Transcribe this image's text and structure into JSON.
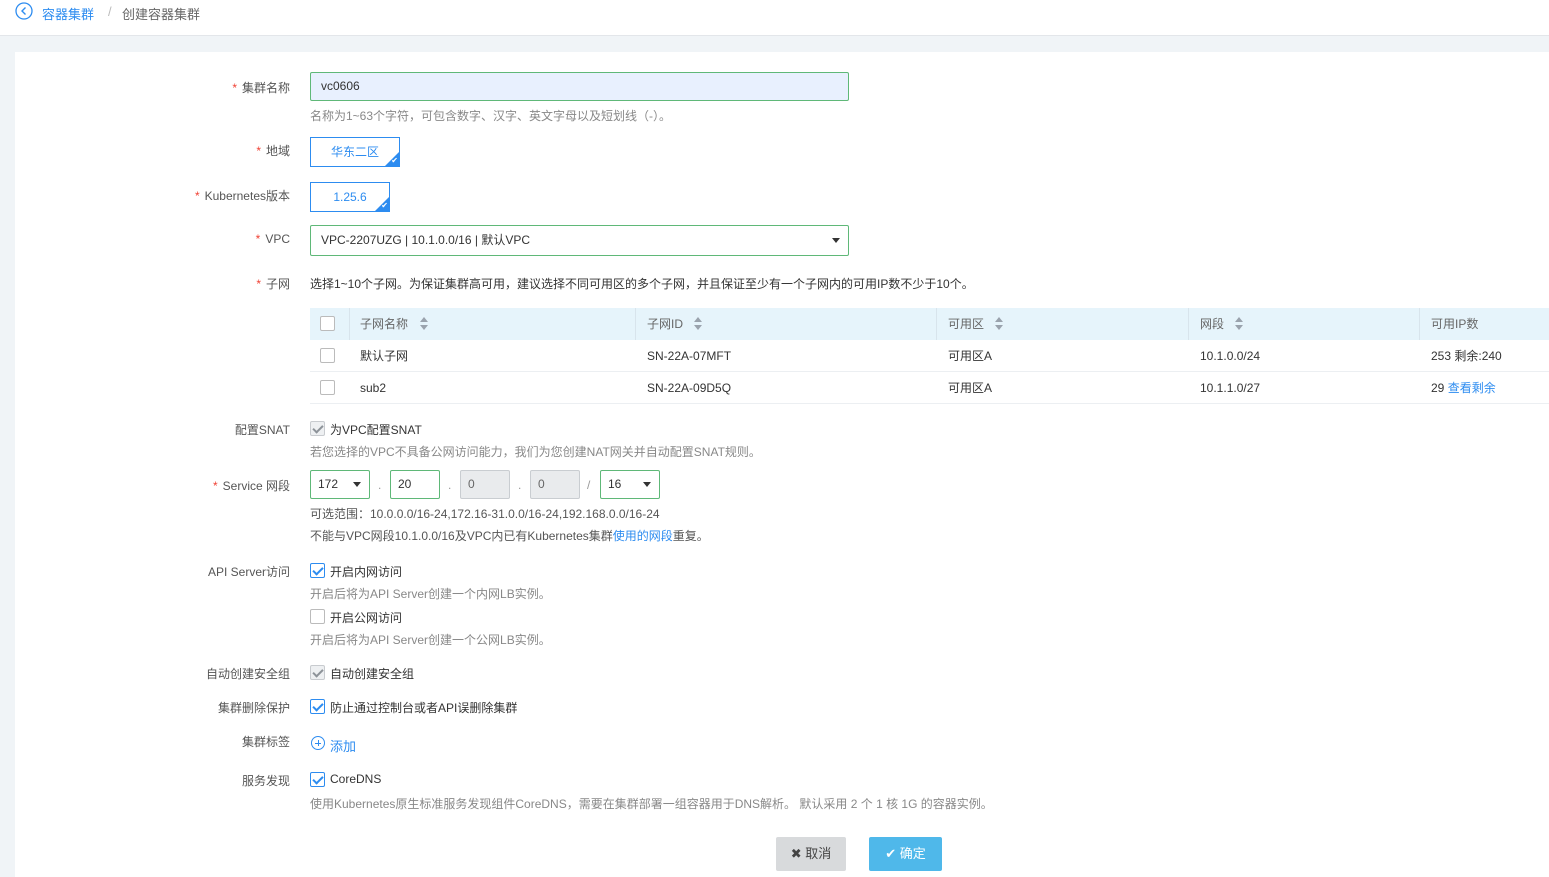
{
  "breadcrumb": {
    "parent": "容器集群",
    "separator": "/",
    "current": "创建容器集群"
  },
  "form": {
    "cluster_name": {
      "label": "集群名称",
      "value": "vc0606",
      "hint": "名称为1~63个字符，可包含数字、汉字、英文字母以及短划线（-）。"
    },
    "region": {
      "label": "地域",
      "value": "华东二区"
    },
    "k8s_version": {
      "label": "Kubernetes版本",
      "value": "1.25.6"
    },
    "vpc": {
      "label": "VPC",
      "value": "VPC-2207UZG | 10.1.0.0/16 | 默认VPC"
    },
    "subnet": {
      "label": "子网",
      "hint": "选择1~10个子网。为保证集群高可用，建议选择不同可用区的多个子网，并且保证至少有一个子网内的可用IP数不少于10个。",
      "columns": [
        "子网名称",
        "子网ID",
        "可用区",
        "网段",
        "可用IP数"
      ],
      "rows": [
        {
          "name": "默认子网",
          "id": "SN-22A-07MFT",
          "zone": "可用区A",
          "cidr": "10.1.0.0/24",
          "ip_count": "253",
          "ip_extra": "剩余:240",
          "ip_extra_link": false
        },
        {
          "name": "sub2",
          "id": "SN-22A-09D5Q",
          "zone": "可用区A",
          "cidr": "10.1.1.0/27",
          "ip_count": "29",
          "ip_extra": "查看剩余",
          "ip_extra_link": true
        }
      ]
    },
    "snat": {
      "label": "配置SNAT",
      "checkbox": "为VPC配置SNAT",
      "hint": "若您选择的VPC不具备公网访问能力，我们为您创建NAT网关并自动配置SNAT规则。"
    },
    "service_cidr": {
      "label": "Service 网段",
      "octet1": "172",
      "octet2": "20",
      "octet3": "0",
      "octet4": "0",
      "mask": "16",
      "dot": ".",
      "slash": "/",
      "range_hint": "可选范围：10.0.0.0/16-24,172.16-31.0.0/16-24,192.168.0.0/16-24",
      "conflict_prefix": "不能与VPC网段10.1.0.0/16及VPC内已有Kubernetes集群",
      "conflict_link": "使用的网段",
      "conflict_suffix": "重复。"
    },
    "api_server": {
      "label": "API Server访问",
      "internal": "开启内网访问",
      "internal_hint": "开启后将为API Server创建一个内网LB实例。",
      "public": "开启公网访问",
      "public_hint": "开启后将为API Server创建一个公网LB实例。"
    },
    "security_group": {
      "label": "自动创建安全组",
      "checkbox": "自动创建安全组"
    },
    "delete_protection": {
      "label": "集群删除保护",
      "checkbox": "防止通过控制台或者API误删除集群"
    },
    "cluster_tags": {
      "label": "集群标签",
      "add": "添加"
    },
    "service_discovery": {
      "label": "服务发现",
      "checkbox": "CoreDNS",
      "hint": "使用Kubernetes原生标准服务发现组件CoreDNS，需要在集群部署一组容器用于DNS解析。 默认采用 2 个 1 核 1G 的容器实例。"
    }
  },
  "required_mark": "*",
  "buttons": {
    "cancel": "取消",
    "confirm": "确定"
  },
  "colors": {
    "accent": "#2d8cf0",
    "valid_border": "#5fb878",
    "required": "#f04134",
    "confirm_bg": "#4fb8ea"
  }
}
